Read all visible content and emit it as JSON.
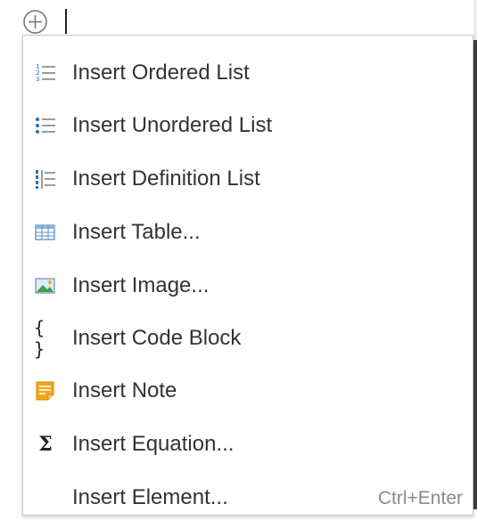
{
  "menu": {
    "items": [
      {
        "label": "Insert Ordered List",
        "icon": "ordered-list-icon"
      },
      {
        "label": "Insert Unordered List",
        "icon": "unordered-list-icon"
      },
      {
        "label": "Insert Definition List",
        "icon": "definition-list-icon"
      },
      {
        "label": "Insert Table...",
        "icon": "table-icon"
      },
      {
        "label": "Insert Image...",
        "icon": "image-icon"
      },
      {
        "label": "Insert Code Block",
        "icon": "code-block-icon",
        "glyph": "{ }"
      },
      {
        "label": "Insert Note",
        "icon": "note-icon"
      },
      {
        "label": "Insert Equation...",
        "icon": "equation-icon",
        "glyph": "Σ"
      },
      {
        "label": "Insert Element...",
        "shortcut": "Ctrl+Enter"
      }
    ]
  },
  "colors": {
    "icon_blue": "#2c6fb7",
    "note_orange": "#f2a81d",
    "menu_border": "#c9c9c9"
  }
}
